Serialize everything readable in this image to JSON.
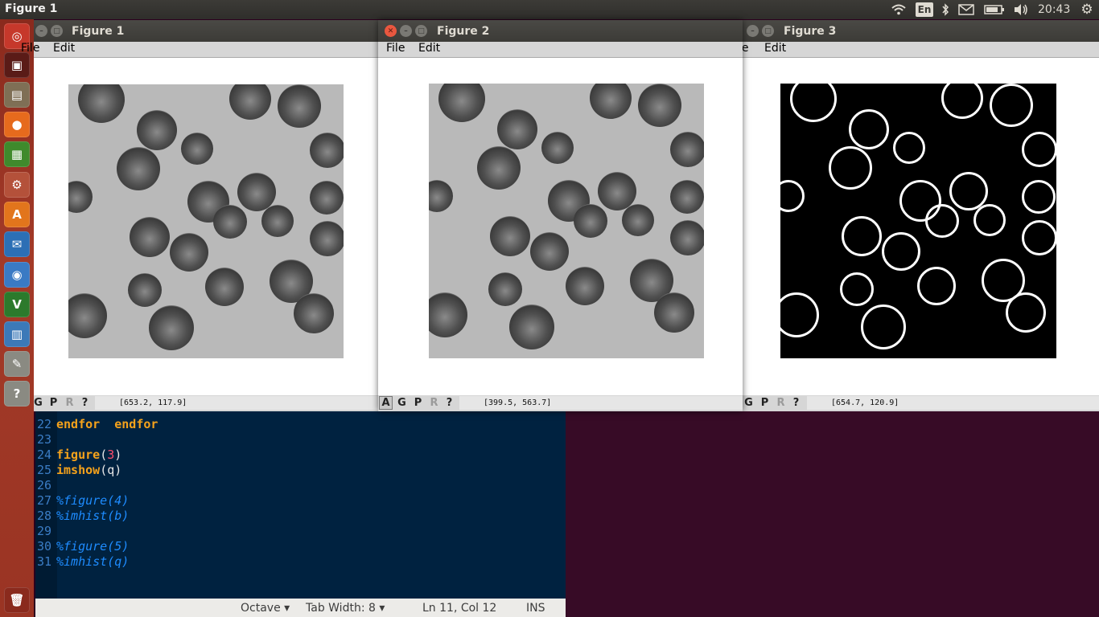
{
  "topbar": {
    "title": "Figure 1",
    "language": "En",
    "clock": "20:43"
  },
  "launcher": {
    "items": [
      {
        "name": "ubuntu-dash",
        "glyph": "◎",
        "color": "#c6382b"
      },
      {
        "name": "terminal",
        "glyph": "▣",
        "color": "#5a1b17"
      },
      {
        "name": "files",
        "glyph": "▤",
        "color": "#7f6f55"
      },
      {
        "name": "firefox",
        "glyph": "●",
        "color": "#e66a1d"
      },
      {
        "name": "libreoffice",
        "glyph": "▦",
        "color": "#3f8a2c"
      },
      {
        "name": "settings",
        "glyph": "⚙",
        "color": "#b4513a"
      },
      {
        "name": "software-center",
        "glyph": "A",
        "color": "#e2751c"
      },
      {
        "name": "thunderbird",
        "glyph": "✉",
        "color": "#2c6fb5"
      },
      {
        "name": "chromium",
        "glyph": "◉",
        "color": "#3a7ac4"
      },
      {
        "name": "vim",
        "glyph": "V",
        "color": "#2c7a2c"
      },
      {
        "name": "document-viewer",
        "glyph": "▥",
        "color": "#3c79b8"
      },
      {
        "name": "text-editor",
        "glyph": "✎",
        "color": "#8a8a82"
      },
      {
        "name": "help",
        "glyph": "?",
        "color": "#8a8a82"
      },
      {
        "name": "trash",
        "glyph": "🗑",
        "color": "#8a2a1d"
      }
    ]
  },
  "figures": [
    {
      "title": "Figure 1",
      "menu_file": "File",
      "menu_edit": "Edit",
      "coords": "[653.2, 117.9]"
    },
    {
      "title": "Figure 2",
      "menu_file": "File",
      "menu_edit": "Edit",
      "coords": "[399.5, 563.7]"
    },
    {
      "title": "Figure 3",
      "menu_file": "File",
      "menu_edit": "Edit",
      "coords": "[654.7, 120.9]"
    }
  ],
  "toolbar": {
    "a": "A",
    "g": "G",
    "p": "P",
    "r": "R",
    "help": "?"
  },
  "editor": {
    "lines": [
      {
        "n": "22",
        "code": "endfor",
        "kind": "kw"
      },
      {
        "n": "23",
        "code": "",
        "kind": "plain"
      },
      {
        "n": "24",
        "code_kw": "figure",
        "code_open": "(",
        "code_num": "3",
        "code_close": ")",
        "kind": "call"
      },
      {
        "n": "25",
        "code_kw": "imshow",
        "code_rest": "(q)",
        "kind": "call2"
      },
      {
        "n": "26",
        "code": "",
        "kind": "plain"
      },
      {
        "n": "27",
        "code": "%figure(4)",
        "kind": "cmt"
      },
      {
        "n": "28",
        "code": "%imhist(b)",
        "kind": "cmt"
      },
      {
        "n": "29",
        "code": "",
        "kind": "plain"
      },
      {
        "n": "30",
        "code": "%figure(5)",
        "kind": "cmt"
      },
      {
        "n": "31",
        "code": "%imhist(q)",
        "kind": "cmt"
      }
    ],
    "partial_line": "endfor"
  },
  "statusbar": {
    "language": "Octave ▾",
    "tab_width": "Tab Width: 8 ▾",
    "position": "Ln 11, Col 12",
    "mode": "INS"
  }
}
